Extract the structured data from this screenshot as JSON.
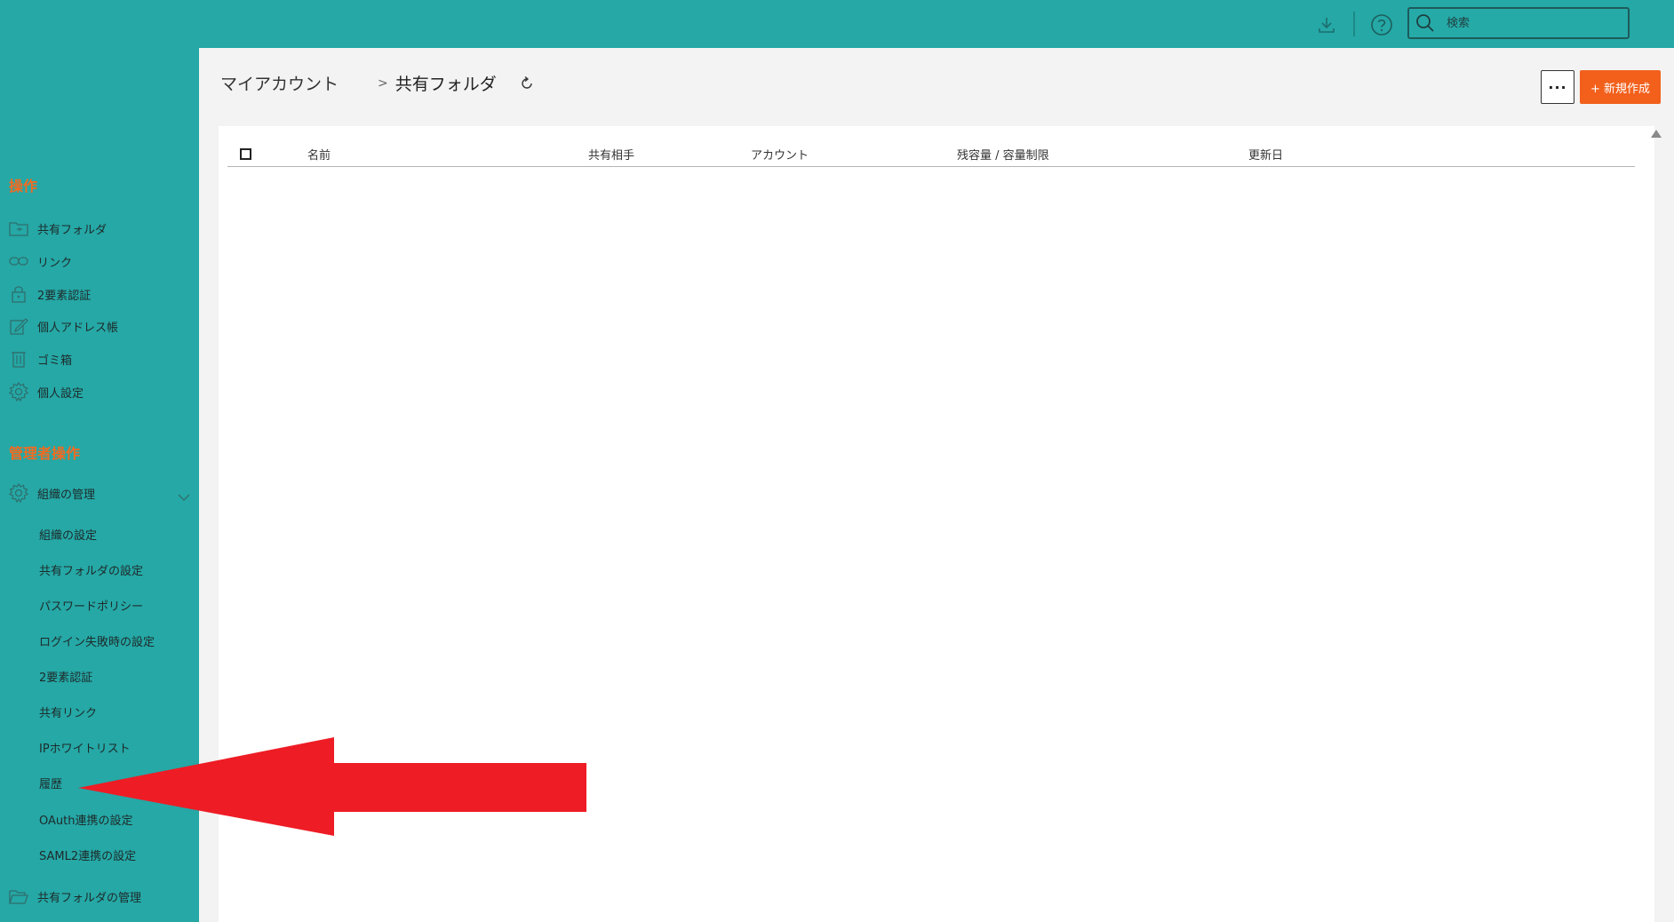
{
  "topbar": {
    "search_placeholder": "検索",
    "icons": [
      "download-icon",
      "help-icon",
      "search-icon"
    ]
  },
  "sidebar": {
    "section_operations": "操作",
    "section_admin": "管理者操作",
    "items": [
      {
        "label": "共有フォルダ",
        "icon": "folder-icon"
      },
      {
        "label": "リンク",
        "icon": "link-icon"
      },
      {
        "label": "2要素認証",
        "icon": "lock-icon"
      },
      {
        "label": "個人アドレス帳",
        "icon": "edit-icon"
      },
      {
        "label": "ゴミ箱",
        "icon": "trash-icon"
      },
      {
        "label": "個人設定",
        "icon": "gear-icon"
      }
    ],
    "org": {
      "label": "組織の管理",
      "icon": "gear-icon"
    },
    "org_subitems": [
      "組織の設定",
      "共有フォルダの設定",
      "パスワードポリシー",
      "ログイン失敗時の設定",
      "2要素認証",
      "共有リンク",
      "IPホワイトリスト",
      "履歴",
      "OAuth連携の設定",
      "SAML2連携の設定"
    ],
    "shared_folder_admin": {
      "label": "共有フォルダの管理",
      "icon": "folder-open-icon"
    }
  },
  "breadcrumb": {
    "root": "マイアカウント",
    "separator": ">",
    "current": "共有フォルダ"
  },
  "toolbar": {
    "more_label": "···",
    "new_label": "+ 新規作成"
  },
  "table": {
    "columns": [
      "名前",
      "共有相手",
      "アカウント",
      "残容量 / 容量制限",
      "更新日"
    ],
    "rows": []
  },
  "colors": {
    "teal": "#25a8a6",
    "accent_orange": "#f2601c",
    "annotation_red": "#ee1c25"
  }
}
